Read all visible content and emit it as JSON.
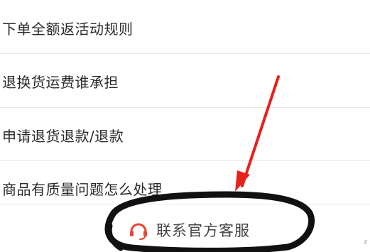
{
  "faq": {
    "items": [
      {
        "label": "下单全额返活动规则"
      },
      {
        "label": "退换货运费谁承担"
      },
      {
        "label": "申请退货退款/退款"
      },
      {
        "label": "商品有质量问题怎么处理"
      }
    ]
  },
  "contact": {
    "label": "联系官方客服",
    "icon": "headset-icon",
    "icon_color": "#e8452f"
  },
  "annotation": {
    "arrow_color": "#e8201c",
    "circle_color": "#111111"
  },
  "corner_mark": "z"
}
